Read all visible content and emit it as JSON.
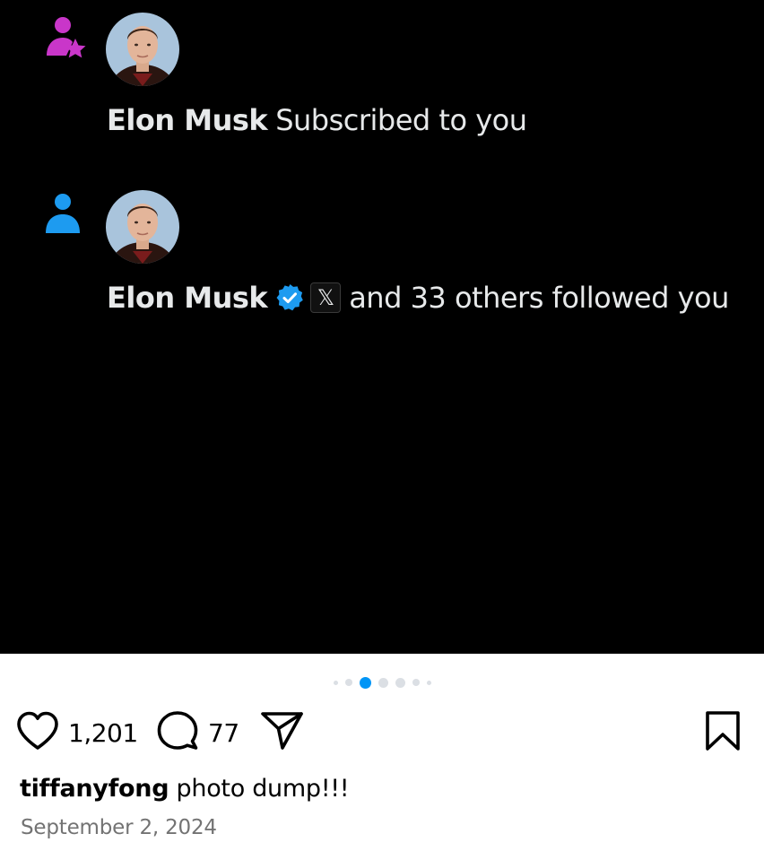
{
  "post_image": {
    "notifications": [
      {
        "type_icon": "person-star-icon",
        "type_icon_color": "#c936c9",
        "avatar": "elon-musk-avatar",
        "name": "Elon Musk",
        "text": "Subscribed to you",
        "verified": false
      },
      {
        "type_icon": "person-icon",
        "type_icon_color": "#1d9bf0",
        "avatar": "elon-musk-avatar",
        "name": "Elon Musk",
        "affiliate_badge": "𝕏",
        "text": "and 33 others followed you",
        "verified": true,
        "verified_color": "#1d9bf0"
      }
    ]
  },
  "carousel": {
    "total": 7,
    "active_index": 2,
    "active_color": "#0095f6"
  },
  "actions": {
    "like_icon": "heart-icon",
    "like_count": "1,201",
    "comment_icon": "comment-icon",
    "comment_count": "77",
    "share_icon": "send-icon",
    "save_icon": "bookmark-icon"
  },
  "caption": {
    "username": "tiffanyfong",
    "text": "photo dump!!!"
  },
  "date": "September 2, 2024"
}
